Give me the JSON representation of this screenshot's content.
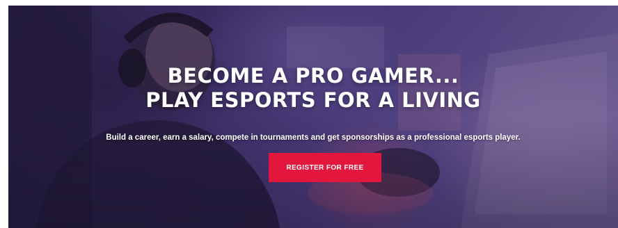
{
  "hero": {
    "headline_line1": "BECOME A PRO GAMER...",
    "headline_line2": "PLAY ESPORTS FOR A LIVING",
    "subtitle": "Build a career, earn a salary, compete in tournaments and get sponsorships as a professional esports player.",
    "cta_label": "REGISTER FOR FREE"
  },
  "colors": {
    "cta_background": "#e3173e",
    "text": "#ffffff",
    "overlay_tint": "#3c2f66"
  }
}
